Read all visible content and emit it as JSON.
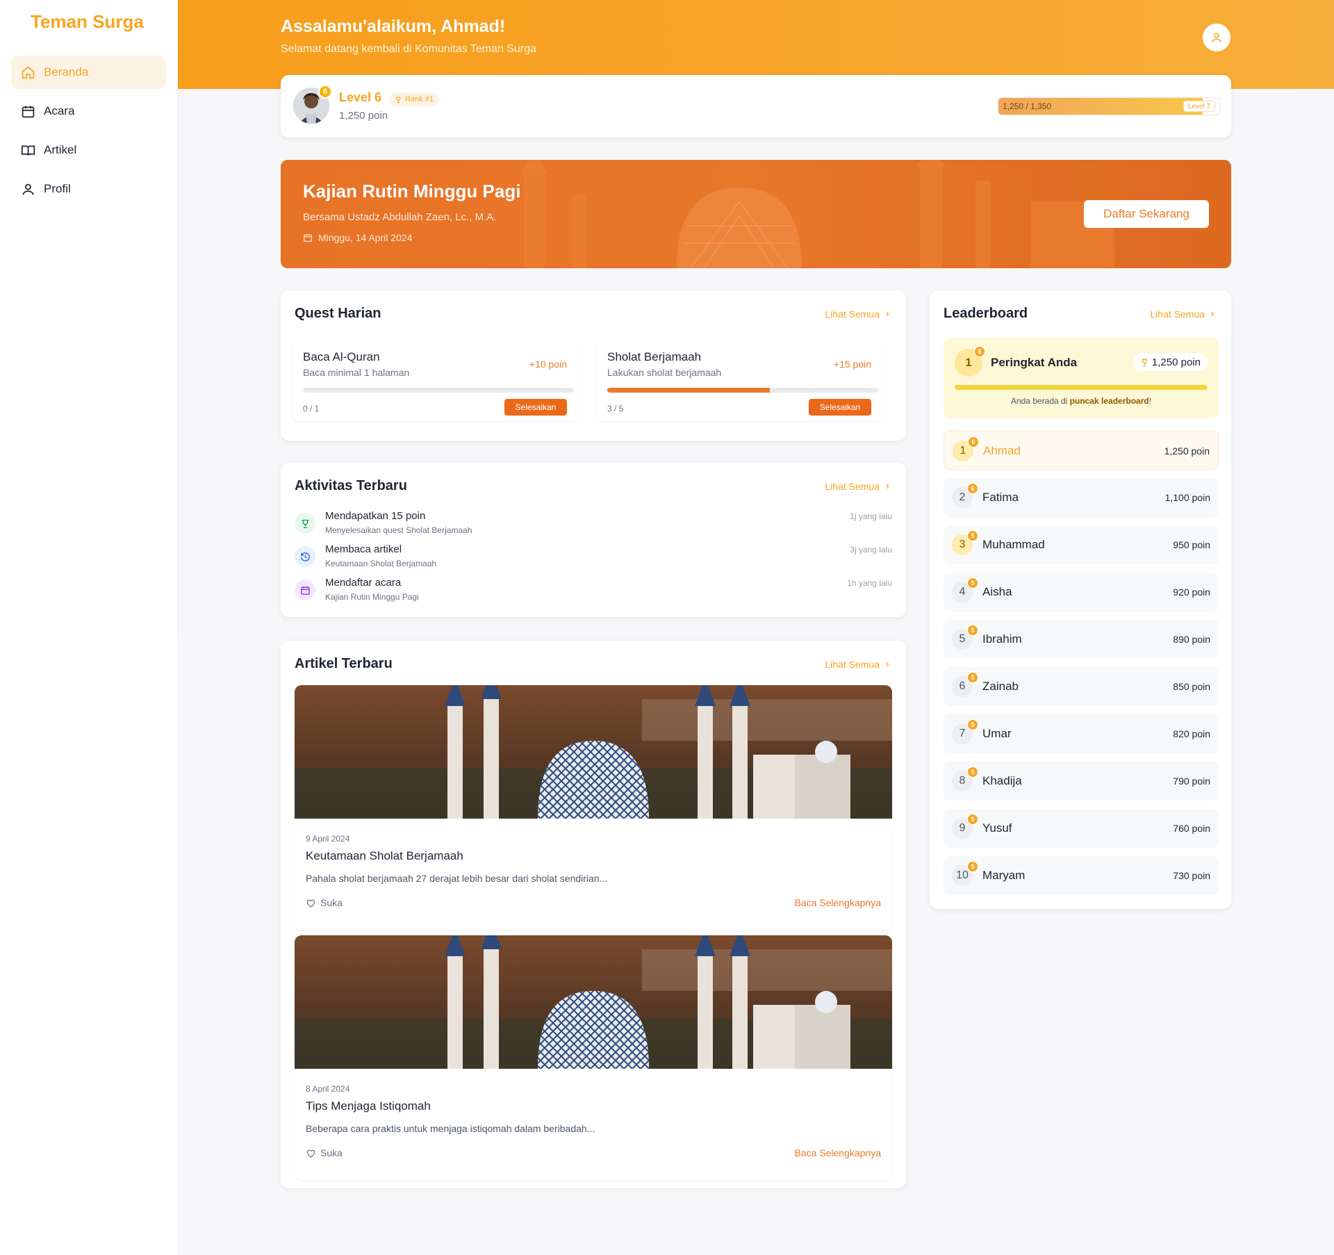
{
  "brand": "Teman Surga",
  "colors": {
    "accent": "#f5a623",
    "orange": "#ea7a2c",
    "header": "#f79e1b"
  },
  "nav": [
    {
      "label": "Beranda",
      "icon": "home-icon",
      "active": true
    },
    {
      "label": "Acara",
      "icon": "calendar-icon",
      "active": false
    },
    {
      "label": "Artikel",
      "icon": "book-icon",
      "active": false
    },
    {
      "label": "Profil",
      "icon": "user-icon",
      "active": false
    }
  ],
  "header": {
    "greeting": "Assalamu'alaikum, Ahmad!",
    "subtitle": "Selamat datang kembali di Komunitas Teman Surga"
  },
  "level": {
    "badge": "6",
    "title": "Level 6",
    "rank": "Rank #1",
    "points": "1,250 poin",
    "progress_text": "1,250 / 1,350",
    "progress_fraction": 0.926,
    "next_level": "Level 7"
  },
  "banner": {
    "title": "Kajian Rutin Minggu Pagi",
    "subtitle": "Bersama Ustadz Abdullah Zaen, Lc., M.A.",
    "date": "Minggu, 14 April 2024",
    "button": "Daftar Sekarang"
  },
  "quest": {
    "title": "Quest Harian",
    "see_all": "Lihat Semua",
    "items": [
      {
        "name": "Baca Al-Quran",
        "desc": "Baca minimal 1 halaman",
        "points": "+10 poin",
        "count": "0 / 1",
        "progress": 0,
        "button": "Selesaikan"
      },
      {
        "name": "Sholat Berjamaah",
        "desc": "Lakukan sholat berjamaah",
        "points": "+15 poin",
        "count": "3 / 5",
        "progress": 0.6,
        "button": "Selesaikan"
      }
    ]
  },
  "activity": {
    "title": "Aktivitas Terbaru",
    "see_all": "Lihat Semua",
    "items": [
      {
        "title": "Mendapatkan 15 poin",
        "sub": "Menyelesaikan quest Sholat Berjamaah",
        "time": "1j yang lalu",
        "icon": "trophy-icon",
        "color": "#16a34a",
        "bg": "#e8f7ee"
      },
      {
        "title": "Membaca artikel",
        "sub": "Keutamaan Sholat Berjamaah",
        "time": "3j yang lalu",
        "icon": "history-icon",
        "color": "#2563eb",
        "bg": "#e8f0fd"
      },
      {
        "title": "Mendaftar acara",
        "sub": "Kajian Rutin Minggu Pagi",
        "time": "1h yang lalu",
        "icon": "calendar-icon",
        "color": "#9333ea",
        "bg": "#f3e8fd"
      }
    ]
  },
  "articles": {
    "title": "Artikel Terbaru",
    "see_all": "Lihat Semua",
    "items": [
      {
        "date": "9 April 2024",
        "title": "Keutamaan Sholat Berjamaah",
        "excerpt": "Pahala sholat berjamaah 27 derajat lebih besar dari sholat sendirian...",
        "like": "Suka",
        "read": "Baca Selengkapnya"
      },
      {
        "date": "8 April 2024",
        "title": "Tips Menjaga Istiqomah",
        "excerpt": "Beberapa cara praktis untuk menjaga istiqomah dalam beribadah...",
        "like": "Suka",
        "read": "Baca Selengkapnya"
      }
    ]
  },
  "leaderboard": {
    "title": "Leaderboard",
    "see_all": "Lihat Semua",
    "my_rank": {
      "rank": "1",
      "badge": "6",
      "label": "Peringkat Anda",
      "points": "1,250 poin",
      "note_prefix": "Anda berada di ",
      "note_bold": "puncak leaderboard",
      "note_suffix": "!"
    },
    "rows": [
      {
        "rank": "1",
        "badge": "6",
        "name": "Ahmad",
        "points": "1,250 poin",
        "me": true,
        "gold": true
      },
      {
        "rank": "2",
        "badge": "6",
        "name": "Fatima",
        "points": "1,100 poin",
        "me": false,
        "gold": false
      },
      {
        "rank": "3",
        "badge": "5",
        "name": "Muhammad",
        "points": "950 poin",
        "me": false,
        "gold": true
      },
      {
        "rank": "4",
        "badge": "5",
        "name": "Aisha",
        "points": "920 poin",
        "me": false,
        "gold": false
      },
      {
        "rank": "5",
        "badge": "5",
        "name": "Ibrahim",
        "points": "890 poin",
        "me": false,
        "gold": false
      },
      {
        "rank": "6",
        "badge": "5",
        "name": "Zainab",
        "points": "850 poin",
        "me": false,
        "gold": false
      },
      {
        "rank": "7",
        "badge": "5",
        "name": "Umar",
        "points": "820 poin",
        "me": false,
        "gold": false
      },
      {
        "rank": "8",
        "badge": "5",
        "name": "Khadija",
        "points": "790 poin",
        "me": false,
        "gold": false
      },
      {
        "rank": "9",
        "badge": "5",
        "name": "Yusuf",
        "points": "760 poin",
        "me": false,
        "gold": false
      },
      {
        "rank": "10",
        "badge": "5",
        "name": "Maryam",
        "points": "730 poin",
        "me": false,
        "gold": false
      }
    ]
  }
}
